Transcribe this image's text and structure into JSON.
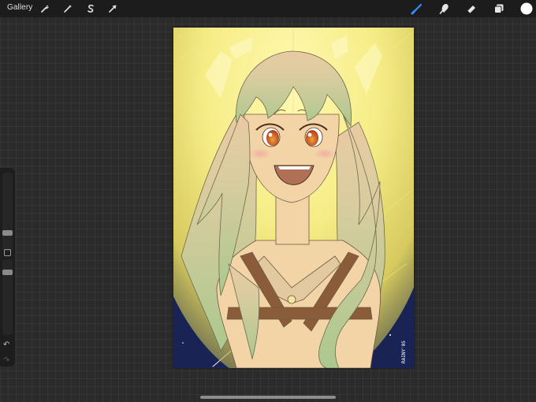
{
  "app": {
    "gallery_label": "Gallery"
  },
  "toolbar_left": {
    "tools": [
      "wrench-icon",
      "magic-wand-icon",
      "selection-s-icon",
      "transform-arrow-icon"
    ]
  },
  "toolbar_right": {
    "tools": [
      "brush-icon",
      "smudge-icon",
      "eraser-icon",
      "layers-icon",
      "color-swatch"
    ],
    "active_tool": "brush",
    "accent_color": "#3a8cff",
    "current_color": "#ffffff"
  },
  "sidebar": {
    "brush_size": 0.5,
    "brush_opacity": 0.45,
    "undo_glyph": "↶",
    "redo_glyph": "↷"
  },
  "artwork": {
    "signature": "RAINY'05",
    "colors": {
      "sky": "#1a2454",
      "glow": "#f7f094",
      "hair": "#c9cf9c",
      "skin": "#f2d4a7",
      "strap": "#8a5c3a",
      "eyes": "#c85a20",
      "mouth": "#b07055"
    }
  }
}
